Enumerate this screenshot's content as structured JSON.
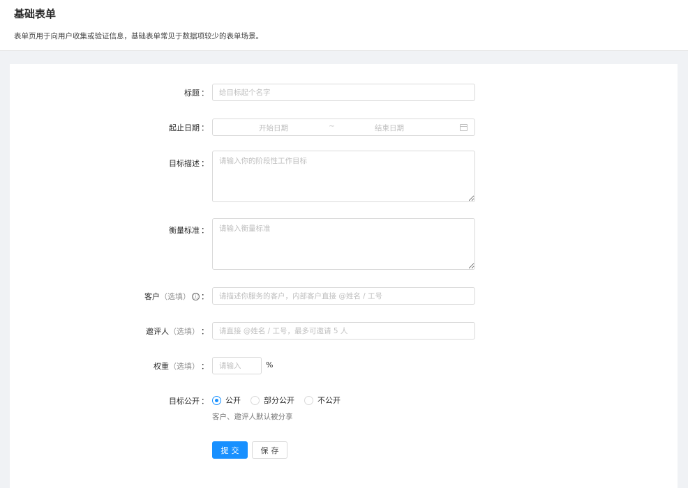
{
  "header": {
    "title": "基础表单",
    "description": "表单页用于向用户收集或验证信息，基础表单常见于数据项较少的表单场景。"
  },
  "form": {
    "title": {
      "label": "标题",
      "placeholder": "给目标起个名字"
    },
    "date_range": {
      "label": "起止日期",
      "start_placeholder": "开始日期",
      "separator": "~",
      "end_placeholder": "结束日期"
    },
    "goal": {
      "label": "目标描述",
      "placeholder": "请输入你的阶段性工作目标"
    },
    "standard": {
      "label": "衡量标准",
      "placeholder": "请输入衡量标准"
    },
    "client": {
      "label": "客户",
      "optional": "（选填）",
      "info_icon": "ⓘ",
      "placeholder": "请描述你服务的客户，内部客户直接 @姓名 / 工号"
    },
    "invites": {
      "label": "邀评人",
      "optional": "（选填）",
      "placeholder": "请直接 @姓名 / 工号，最多可邀请 5 人"
    },
    "weight": {
      "label": "权重",
      "optional": "（选填）",
      "placeholder": "请输入",
      "suffix": "%"
    },
    "public": {
      "label": "目标公开",
      "options": [
        "公开",
        "部分公开",
        "不公开"
      ],
      "selected": "公开",
      "help": "客户、邀评人默认被分享"
    },
    "colon": "：",
    "submit_label": "提交",
    "save_label": "保存"
  },
  "colors": {
    "primary": "#1890ff",
    "background": "#f0f2f5"
  }
}
